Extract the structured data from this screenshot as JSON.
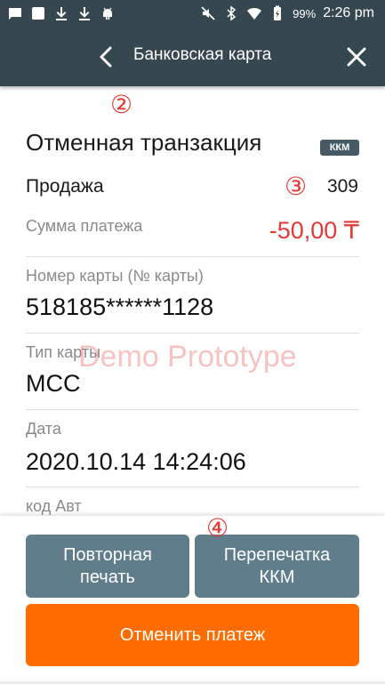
{
  "status_bar": {
    "battery": "99%",
    "time": "2:26 pm",
    "icons": [
      "message-icon",
      "square-icon",
      "download-icon",
      "download-icon",
      "android-icon",
      "mute-icon",
      "bluetooth-icon",
      "wifi-icon",
      "battery-icon"
    ]
  },
  "header": {
    "title": "Банковская карта",
    "back_icon": "chevron-left-icon",
    "close_icon": "close-icon",
    "bg_color": "#37474f"
  },
  "annotations": {
    "marker_2": "②",
    "marker_3": "③",
    "marker_4": "④"
  },
  "transaction": {
    "title": "Отменная транзакция",
    "badge": "ККМ",
    "operation": "Продажа",
    "number": "309"
  },
  "details": {
    "amount_label": "Сумма платежа",
    "amount_value": "-50,00 ₸",
    "card_label": "Номер карты (№ карты)",
    "card_value": "518185******1128",
    "card_type_label": "Тип карты",
    "card_type_value": "MCC",
    "date_label": "Дата",
    "date_value": "2020.10.14 14:24:06",
    "auth_label": "код  Авт"
  },
  "watermark": "Demo Prototype",
  "actions": {
    "reprint_line1": "Повторная",
    "reprint_line2": "печать",
    "reprint_kkm_line1": "Перепечатка",
    "reprint_kkm_line2": "ККМ",
    "cancel_payment": "Отменить платеж"
  },
  "colors": {
    "accent_red": "#e53935",
    "orange_button": "#ff6d00",
    "grey_button": "#607d8b"
  }
}
